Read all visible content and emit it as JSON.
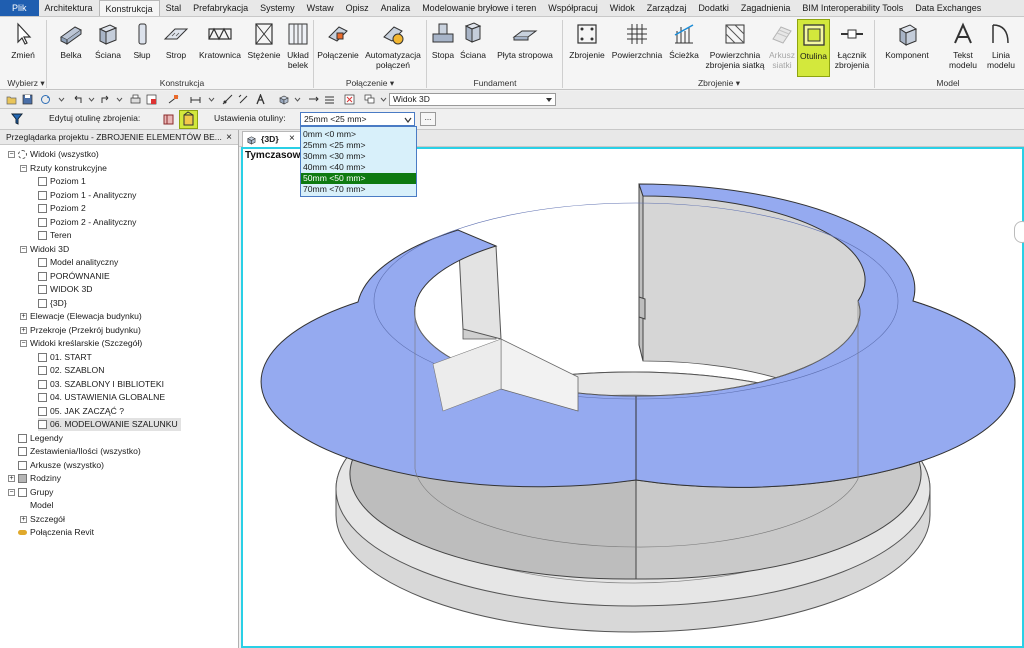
{
  "menu_tabs": [
    "Plik",
    "Architektura",
    "Konstrukcja",
    "Stal",
    "Prefabrykacja",
    "Systemy",
    "Wstaw",
    "Opisz",
    "Analiza",
    "Modelowanie bryłowe i teren",
    "Współpracuj",
    "Widok",
    "Zarządzaj",
    "Dodatki",
    "Zagadnienia",
    "BIM Interoperability Tools",
    "Data Exchanges"
  ],
  "active_tab": "Konstrukcja",
  "ribbon": {
    "tools": {
      "zmien": "Zmień",
      "belka": "Belka",
      "sciana": "Ściana",
      "slup": "Słup",
      "strop": "Strop",
      "kratownica": "Kratownica",
      "stezenie": "Stężenie",
      "uklad_belek": "Układ belek",
      "polaczenie": "Połączenie",
      "automatyzacja": "Automatyzacja połączeń",
      "stopa": "Stopa",
      "sciana_fund": "Ściana",
      "plyta": "Płyta stropowa",
      "zbrojenie": "Zbrojenie",
      "powierzchnia": "Powierzchnia",
      "sciezka": "Ścieżka",
      "powierzchnia_siatka": "Powierzchnia zbrojenia siatką",
      "arkusz": "Arkusz siatki",
      "otulina": "Otulina",
      "lacznik": "Łącznik zbrojenia",
      "komponent": "Komponent",
      "tekst": "Tekst modelu",
      "linia": "Linia modelu"
    },
    "panels": {
      "wybierz": "Wybierz ▾",
      "konstrukcja": "Konstrukcja",
      "polaczenie": "Połączenie ▾",
      "fundament": "Fundament",
      "zbrojenie": "Zbrojenie ▾",
      "model": "Model"
    }
  },
  "quick_access": {
    "view_select": "Widok 3D"
  },
  "options_bar": {
    "edit_label": "Edytuj otulinę zbrojenia:",
    "settings_label": "Ustawienia otuliny:",
    "selected_value": "25mm <25 mm>",
    "ellipsis": "..."
  },
  "dropdown": {
    "options": [
      "0mm <0 mm>",
      "25mm <25 mm>",
      "30mm <30 mm>",
      "40mm <40 mm>",
      "50mm <50 mm>",
      "70mm <70 mm>"
    ],
    "highlighted": "50mm <50 mm>"
  },
  "browser": {
    "title": "Przeglądarka projektu - ZBROJENIE ELEMENTÓW BE...",
    "close": "×",
    "items": [
      "Widoki (wszystko)",
      "Rzuty konstrukcyjne",
      "Poziom 1",
      "Poziom 1 - Analityczny",
      "Poziom 2",
      "Poziom 2 - Analityczny",
      "Teren",
      "Widoki 3D",
      "Model analityczny",
      "PORÓWNANIE",
      "WIDOK 3D",
      "{3D}",
      "Elewacje (Elewacja budynku)",
      "Przekroje (Przekrój budynku)",
      "Widoki kreślarskie (Szczegół)",
      "01. START",
      "02. SZABLON",
      "03. SZABLONY I BIBLIOTEKI",
      "04. USTAWIENIA GLOBALNE",
      "05. JAK ZACZĄĆ ?",
      "06. MODELOWANIE SZALUNKU",
      "Legendy",
      "Zestawienia/Ilości (wszystko)",
      "Arkusze (wszystko)",
      "Rodziny",
      "Grupy",
      "Model",
      "Szczegół",
      "Połączenia Revit"
    ]
  },
  "view": {
    "tab_label": "{3D}",
    "tab_close": "×",
    "viewport_label": "Tymczasow"
  },
  "colors": {
    "file_tab": "#1f5eb0",
    "highlight": "#d3e83c",
    "viewport_border": "#2ad0e6",
    "selected_option": "#0e7a10",
    "top_face": "#95aaf0"
  }
}
